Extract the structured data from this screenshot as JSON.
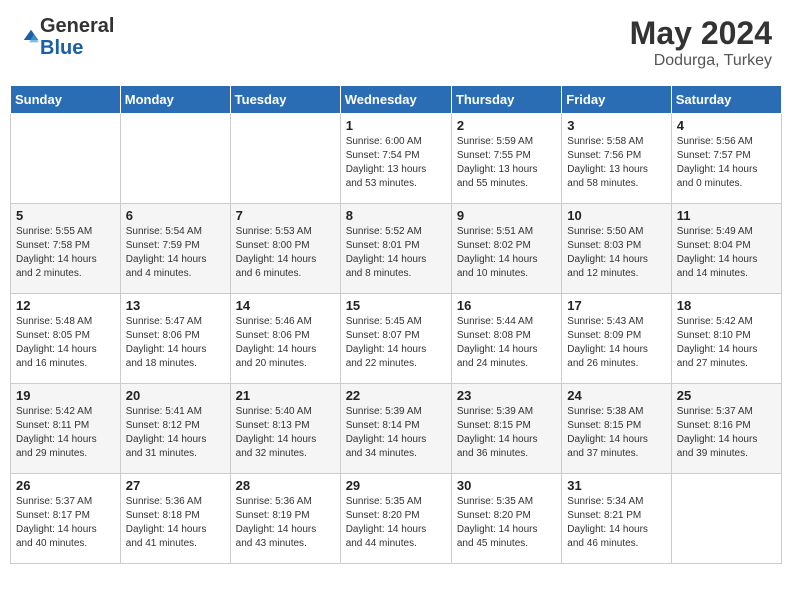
{
  "header": {
    "logo_general": "General",
    "logo_blue": "Blue",
    "month_year": "May 2024",
    "location": "Dodurga, Turkey"
  },
  "days_of_week": [
    "Sunday",
    "Monday",
    "Tuesday",
    "Wednesday",
    "Thursday",
    "Friday",
    "Saturday"
  ],
  "weeks": [
    [
      {
        "day": "",
        "info": ""
      },
      {
        "day": "",
        "info": ""
      },
      {
        "day": "",
        "info": ""
      },
      {
        "day": "1",
        "info": "Sunrise: 6:00 AM\nSunset: 7:54 PM\nDaylight: 13 hours\nand 53 minutes."
      },
      {
        "day": "2",
        "info": "Sunrise: 5:59 AM\nSunset: 7:55 PM\nDaylight: 13 hours\nand 55 minutes."
      },
      {
        "day": "3",
        "info": "Sunrise: 5:58 AM\nSunset: 7:56 PM\nDaylight: 13 hours\nand 58 minutes."
      },
      {
        "day": "4",
        "info": "Sunrise: 5:56 AM\nSunset: 7:57 PM\nDaylight: 14 hours\nand 0 minutes."
      }
    ],
    [
      {
        "day": "5",
        "info": "Sunrise: 5:55 AM\nSunset: 7:58 PM\nDaylight: 14 hours\nand 2 minutes."
      },
      {
        "day": "6",
        "info": "Sunrise: 5:54 AM\nSunset: 7:59 PM\nDaylight: 14 hours\nand 4 minutes."
      },
      {
        "day": "7",
        "info": "Sunrise: 5:53 AM\nSunset: 8:00 PM\nDaylight: 14 hours\nand 6 minutes."
      },
      {
        "day": "8",
        "info": "Sunrise: 5:52 AM\nSunset: 8:01 PM\nDaylight: 14 hours\nand 8 minutes."
      },
      {
        "day": "9",
        "info": "Sunrise: 5:51 AM\nSunset: 8:02 PM\nDaylight: 14 hours\nand 10 minutes."
      },
      {
        "day": "10",
        "info": "Sunrise: 5:50 AM\nSunset: 8:03 PM\nDaylight: 14 hours\nand 12 minutes."
      },
      {
        "day": "11",
        "info": "Sunrise: 5:49 AM\nSunset: 8:04 PM\nDaylight: 14 hours\nand 14 minutes."
      }
    ],
    [
      {
        "day": "12",
        "info": "Sunrise: 5:48 AM\nSunset: 8:05 PM\nDaylight: 14 hours\nand 16 minutes."
      },
      {
        "day": "13",
        "info": "Sunrise: 5:47 AM\nSunset: 8:06 PM\nDaylight: 14 hours\nand 18 minutes."
      },
      {
        "day": "14",
        "info": "Sunrise: 5:46 AM\nSunset: 8:06 PM\nDaylight: 14 hours\nand 20 minutes."
      },
      {
        "day": "15",
        "info": "Sunrise: 5:45 AM\nSunset: 8:07 PM\nDaylight: 14 hours\nand 22 minutes."
      },
      {
        "day": "16",
        "info": "Sunrise: 5:44 AM\nSunset: 8:08 PM\nDaylight: 14 hours\nand 24 minutes."
      },
      {
        "day": "17",
        "info": "Sunrise: 5:43 AM\nSunset: 8:09 PM\nDaylight: 14 hours\nand 26 minutes."
      },
      {
        "day": "18",
        "info": "Sunrise: 5:42 AM\nSunset: 8:10 PM\nDaylight: 14 hours\nand 27 minutes."
      }
    ],
    [
      {
        "day": "19",
        "info": "Sunrise: 5:42 AM\nSunset: 8:11 PM\nDaylight: 14 hours\nand 29 minutes."
      },
      {
        "day": "20",
        "info": "Sunrise: 5:41 AM\nSunset: 8:12 PM\nDaylight: 14 hours\nand 31 minutes."
      },
      {
        "day": "21",
        "info": "Sunrise: 5:40 AM\nSunset: 8:13 PM\nDaylight: 14 hours\nand 32 minutes."
      },
      {
        "day": "22",
        "info": "Sunrise: 5:39 AM\nSunset: 8:14 PM\nDaylight: 14 hours\nand 34 minutes."
      },
      {
        "day": "23",
        "info": "Sunrise: 5:39 AM\nSunset: 8:15 PM\nDaylight: 14 hours\nand 36 minutes."
      },
      {
        "day": "24",
        "info": "Sunrise: 5:38 AM\nSunset: 8:15 PM\nDaylight: 14 hours\nand 37 minutes."
      },
      {
        "day": "25",
        "info": "Sunrise: 5:37 AM\nSunset: 8:16 PM\nDaylight: 14 hours\nand 39 minutes."
      }
    ],
    [
      {
        "day": "26",
        "info": "Sunrise: 5:37 AM\nSunset: 8:17 PM\nDaylight: 14 hours\nand 40 minutes."
      },
      {
        "day": "27",
        "info": "Sunrise: 5:36 AM\nSunset: 8:18 PM\nDaylight: 14 hours\nand 41 minutes."
      },
      {
        "day": "28",
        "info": "Sunrise: 5:36 AM\nSunset: 8:19 PM\nDaylight: 14 hours\nand 43 minutes."
      },
      {
        "day": "29",
        "info": "Sunrise: 5:35 AM\nSunset: 8:20 PM\nDaylight: 14 hours\nand 44 minutes."
      },
      {
        "day": "30",
        "info": "Sunrise: 5:35 AM\nSunset: 8:20 PM\nDaylight: 14 hours\nand 45 minutes."
      },
      {
        "day": "31",
        "info": "Sunrise: 5:34 AM\nSunset: 8:21 PM\nDaylight: 14 hours\nand 46 minutes."
      },
      {
        "day": "",
        "info": ""
      }
    ]
  ]
}
